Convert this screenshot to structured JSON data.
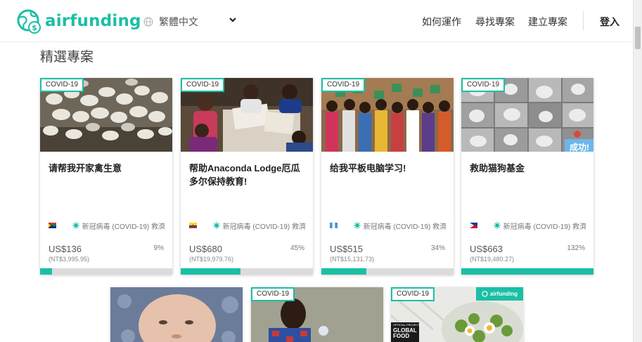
{
  "header": {
    "logo_text": "airfunding",
    "language": "繁體中文",
    "nav": [
      "如何運作",
      "尋找專案",
      "建立專案"
    ],
    "login": "登入"
  },
  "section_title": "精選專案",
  "colors": {
    "accent": "#1bbfa5",
    "success_badge": "#6cb7e8",
    "progress_track": "#dcdcdc"
  },
  "cards": [
    {
      "tag": "COVID-19",
      "title": "请帮我开家禽生意",
      "flag": "south-africa-flag",
      "category": "新冠病毒 (COVID-19) 救濟",
      "amount": "US$136",
      "ntd": "(NT$3,995.95)",
      "percent": "9%",
      "progress": 9,
      "image": "chickens-photo"
    },
    {
      "tag": "COVID-19",
      "title": "帮助Anaconda Lodge厄瓜多尔保持教育!",
      "flag": "ecuador-flag",
      "category": "新冠病毒 (COVID-19) 救濟",
      "amount": "US$680",
      "ntd": "(NT$19,979.76)",
      "percent": "45%",
      "progress": 45,
      "image": "children-studying-photo"
    },
    {
      "tag": "COVID-19",
      "title": "给我平板电脑学习!",
      "flag": "guatemala-flag",
      "category": "新冠病毒 (COVID-19) 救濟",
      "amount": "US$515",
      "ntd": "(NT$15,131.73)",
      "percent": "34%",
      "progress": 34,
      "image": "students-group-photo"
    },
    {
      "tag": "COVID-19",
      "title": "救助猫狗基金",
      "flag": "philippines-flag",
      "category": "新冠病毒 (COVID-19) 救濟",
      "amount": "US$663",
      "ntd": "(NT$19,480.27)",
      "percent": "132%",
      "progress": 100,
      "success": "成功!",
      "image": "cats-dogs-collage-photo"
    }
  ],
  "bottom_cards": [
    {
      "tag": "",
      "image": "baby-photo"
    },
    {
      "tag": "COVID-19",
      "image": "boy-photo"
    },
    {
      "tag": "COVID-19",
      "image": "food-photo",
      "badge": "airfunding",
      "poster_text": [
        "OFFICIAL PROJECT",
        "GLOBAL",
        "FOOD"
      ]
    }
  ]
}
